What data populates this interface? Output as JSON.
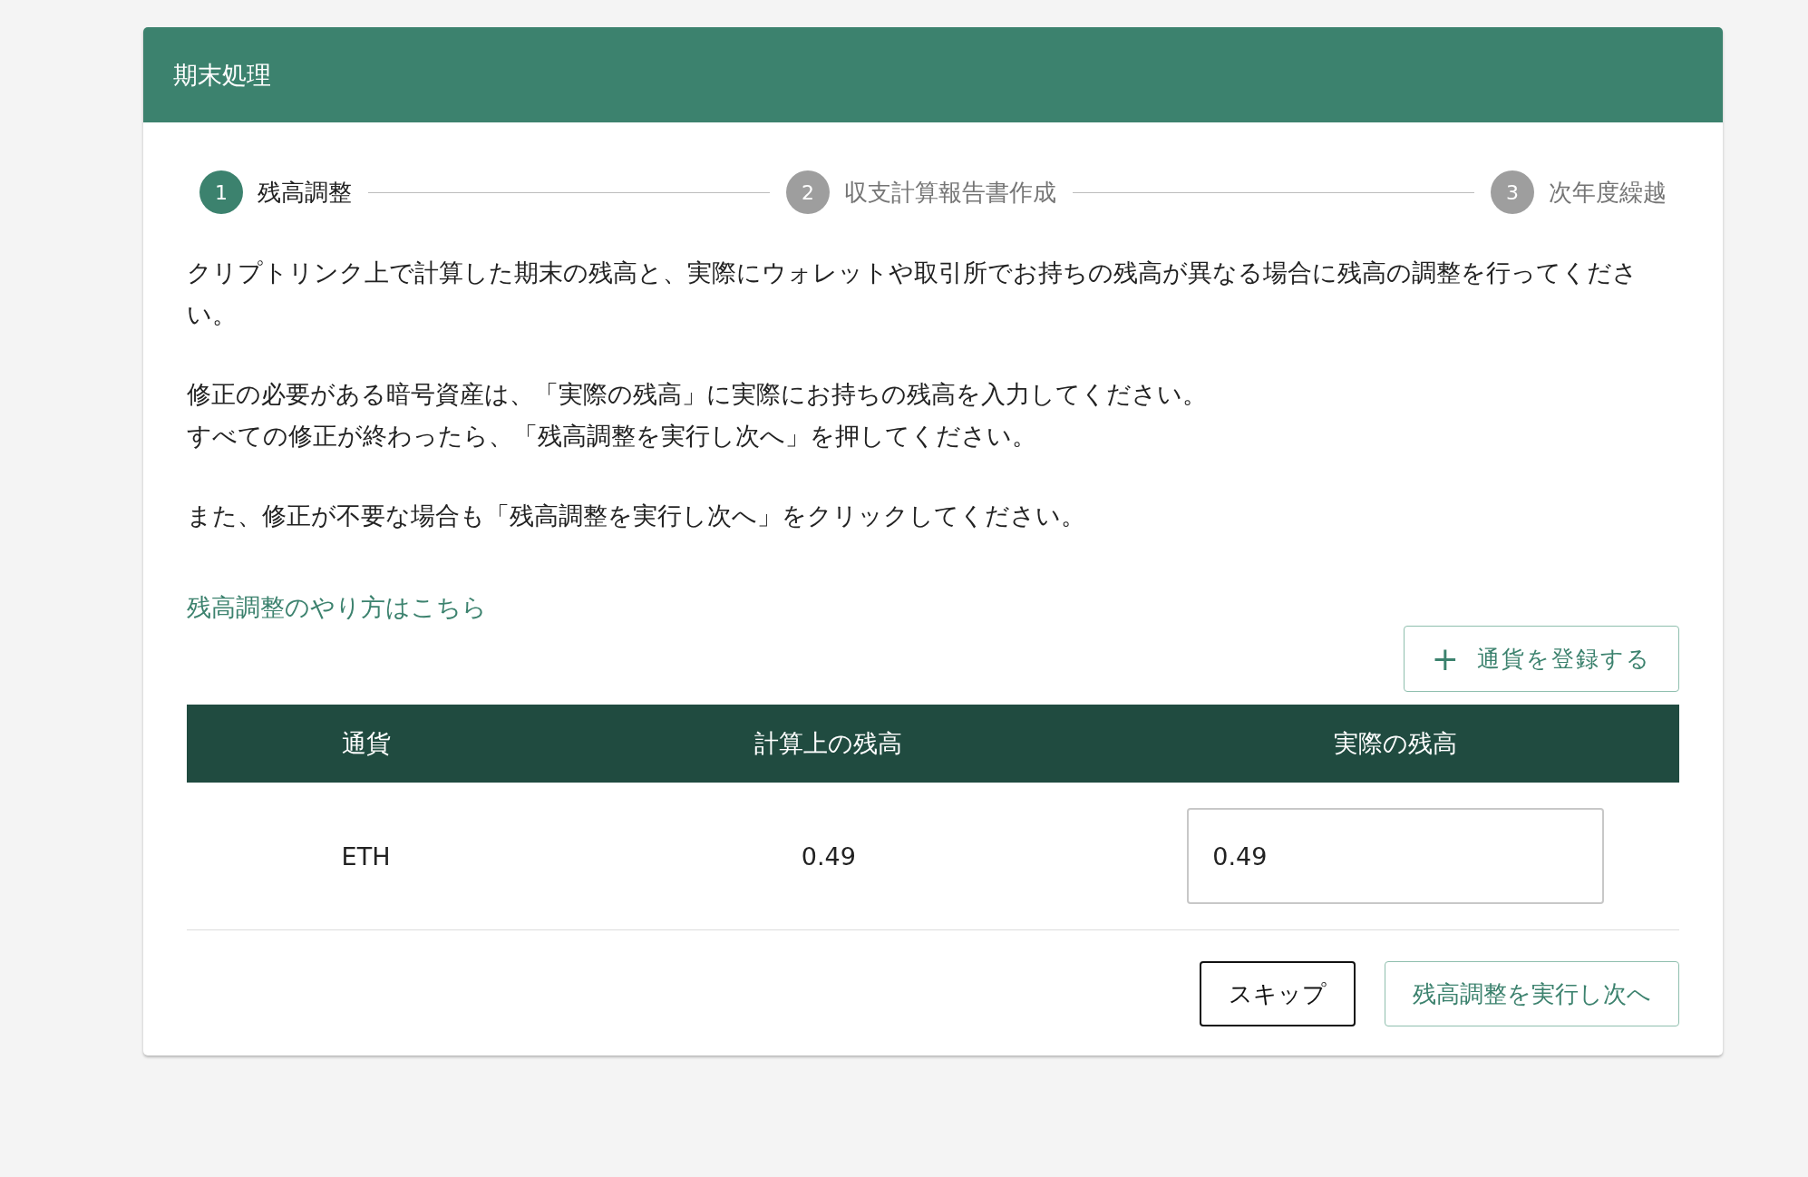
{
  "card": {
    "title": "期末処理"
  },
  "steps": [
    {
      "number": "1",
      "label": "残高調整",
      "selected": true
    },
    {
      "number": "2",
      "label": "収支計算報告書作成",
      "selected": false
    },
    {
      "number": "3",
      "label": "次年度繰越",
      "selected": false
    }
  ],
  "paragraphs": [
    [
      "クリプトリンク上で計算した期末の残高と、実際にウォレットや取引所でお持ちの残高が異なる場合に残高の調整を行ってください。"
    ],
    [
      "修正の必要がある暗号資産は、「実際の残高」に実際にお持ちの残高を入力してください。",
      "すべての修正が終わったら、「残高調整を実行し次へ」を押してください。"
    ],
    [
      "また、修正が不要な場合も「残高調整を実行し次へ」をクリックしてください。"
    ]
  ],
  "help_link": "残高調整のやり方はこちら",
  "register_button": {
    "icon": "+",
    "label": "通貨を登録する"
  },
  "table": {
    "columns": [
      "通貨",
      "計算上の残高",
      "実際の残高"
    ],
    "rows": [
      {
        "currency": "ETH",
        "calculated": "0.49",
        "actual": "0.49"
      }
    ]
  },
  "buttons": {
    "skip": "スキップ",
    "next": "残高調整を実行し次へ"
  }
}
